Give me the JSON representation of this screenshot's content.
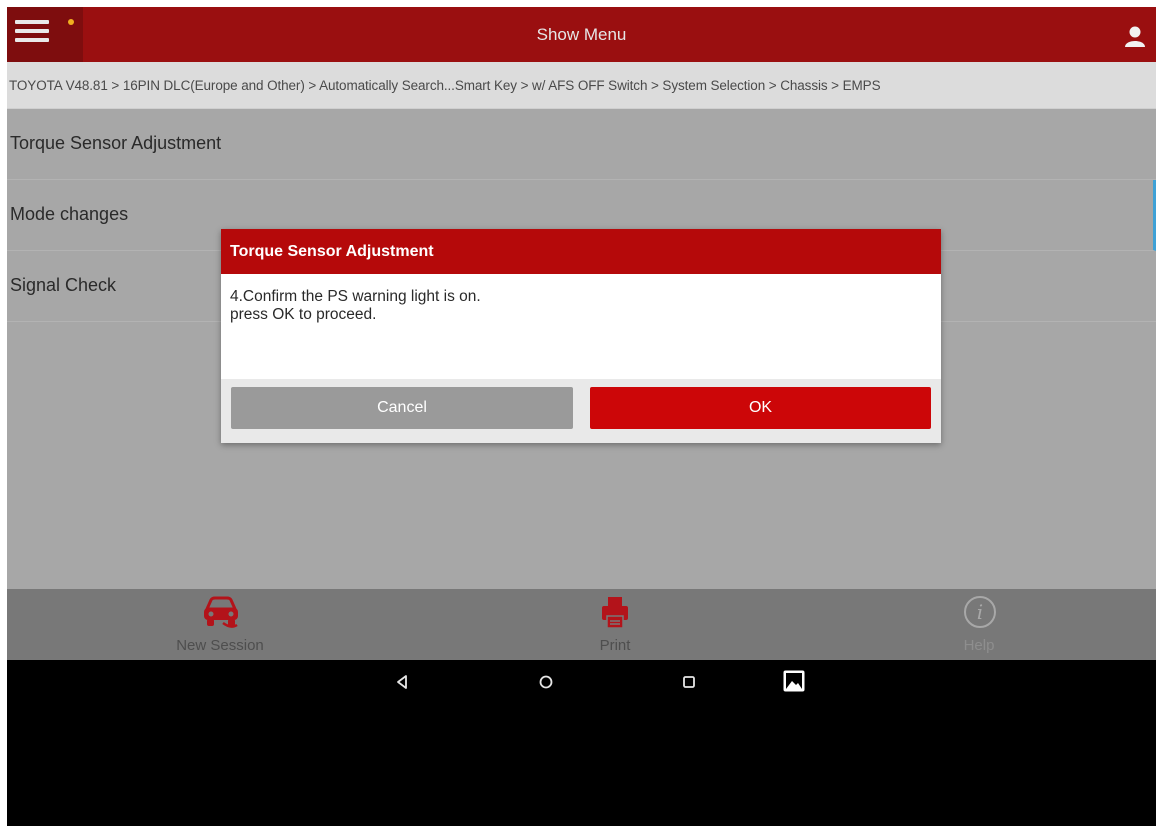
{
  "header": {
    "title": "Show Menu",
    "accent_color": "#9a0f10",
    "menu_icon": "hamburger-icon",
    "user_icon": "user-icon"
  },
  "breadcrumb": {
    "text": "TOYOTA V48.81 > 16PIN DLC(Europe and Other) > Automatically Search...Smart Key > w/ AFS OFF Switch > System Selection > Chassis > EMPS"
  },
  "list": {
    "items": [
      {
        "label": "Torque Sensor Adjustment"
      },
      {
        "label": "Mode changes"
      },
      {
        "label": "Signal Check"
      }
    ]
  },
  "dialog": {
    "title": "Torque Sensor Adjustment",
    "line1": "4.Confirm the PS warning light is on.",
    "line2": "press OK to proceed.",
    "cancel_label": "Cancel",
    "ok_label": "OK"
  },
  "bottom_bar": {
    "items": [
      {
        "label": "New Session",
        "icon": "car-icon"
      },
      {
        "label": "Print",
        "icon": "printer-icon"
      },
      {
        "label": "Help",
        "icon": "info-icon"
      }
    ]
  },
  "nav_bar": {
    "icons": [
      "back-icon",
      "home-icon",
      "recents-icon",
      "screenshot-icon"
    ]
  }
}
